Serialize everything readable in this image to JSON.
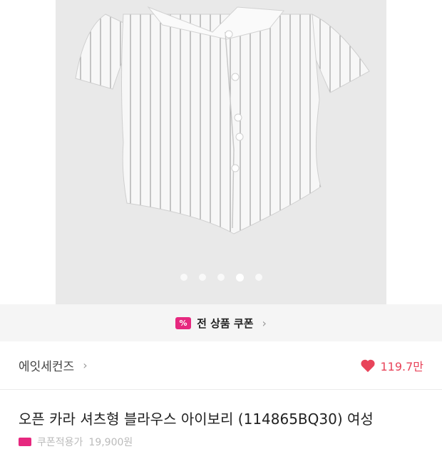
{
  "gallery": {
    "image_alt": "white striped shirt blouse",
    "dot_count": 5,
    "active_dot": 4
  },
  "coupon": {
    "label": "전 상품 쿠폰",
    "icon": "coupon-icon"
  },
  "brand": {
    "name": "에잇세컨즈",
    "likes": "119.7만"
  },
  "product": {
    "title": "오픈 카라 셔츠형 블라우스 아이보리 (114865BQ30) 여성",
    "sub_label": "쿠폰적용가",
    "sub_value": "19,900원"
  }
}
